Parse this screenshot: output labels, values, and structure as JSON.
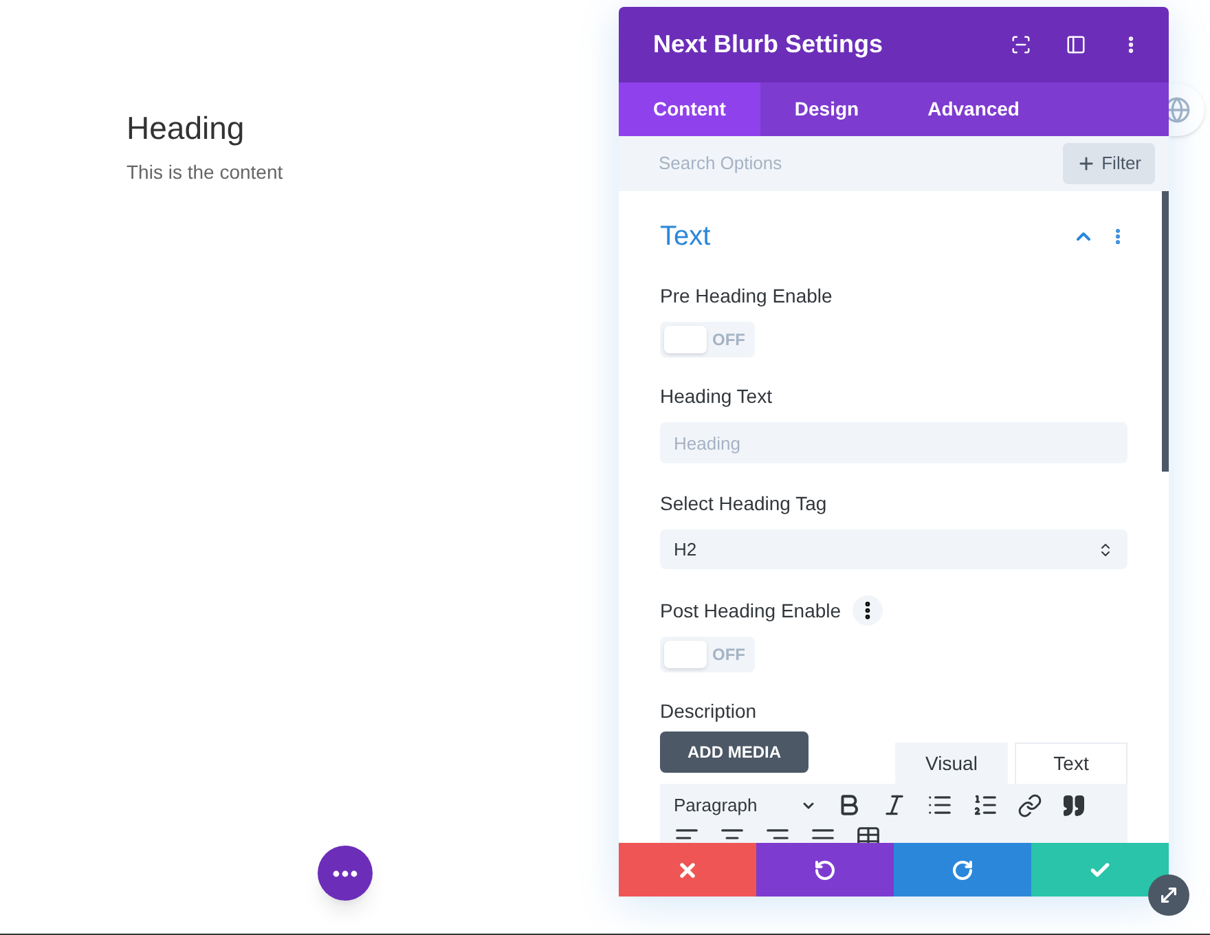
{
  "page": {
    "heading": "Heading",
    "content": "This is the content"
  },
  "panel": {
    "title": "Next Blurb Settings",
    "tabs": [
      {
        "label": "Content",
        "selected": true
      },
      {
        "label": "Design",
        "selected": false
      },
      {
        "label": "Advanced",
        "selected": false
      }
    ],
    "search": {
      "placeholder": "Search Options"
    },
    "filter_button": "Filter",
    "section": {
      "title": "Text",
      "expanded": true
    },
    "fields": [
      {
        "kind": "toggle",
        "label": "Pre Heading Enable",
        "on": false,
        "state_text": "OFF",
        "has_menu": false
      },
      {
        "kind": "text",
        "label": "Heading Text",
        "placeholder": "Heading"
      },
      {
        "kind": "select",
        "label": "Select Heading Tag",
        "value": "H2"
      },
      {
        "kind": "toggle",
        "label": "Post Heading Enable",
        "on": false,
        "state_text": "OFF",
        "has_menu": true
      },
      {
        "kind": "editor",
        "label": "Description",
        "add_media": "ADD MEDIA",
        "editor_tabs": [
          {
            "label": "Visual",
            "selected": true
          },
          {
            "label": "Text",
            "selected": false
          }
        ],
        "format": "Paragraph"
      }
    ]
  }
}
